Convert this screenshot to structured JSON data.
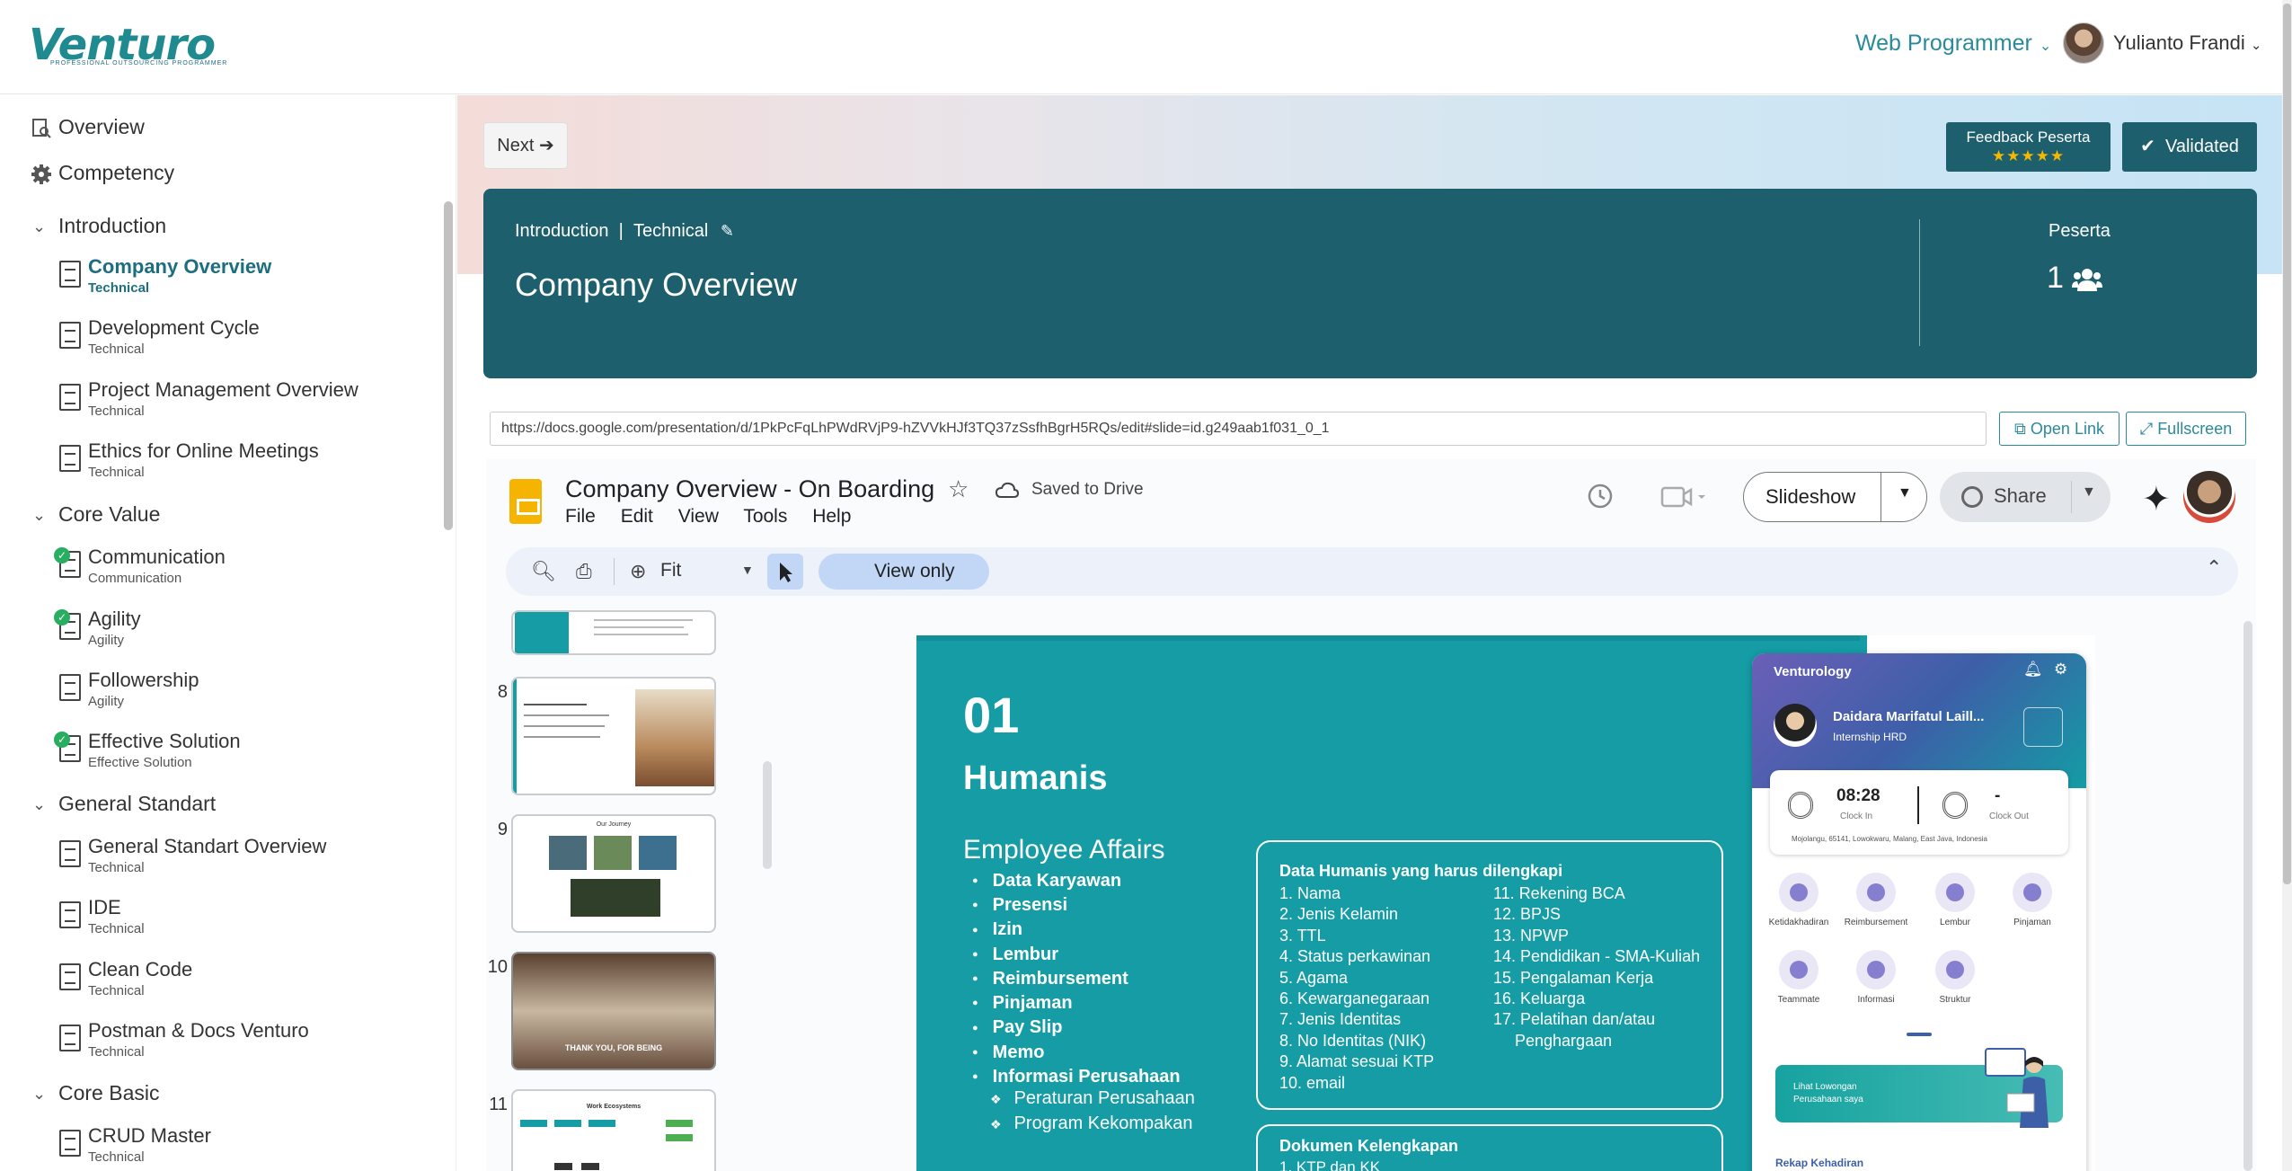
{
  "header": {
    "logo_text": "Venturo",
    "logo_tagline": "PROFESSIONAL OUTSOURCING PROGRAMMER",
    "role_label": "Web Programmer",
    "user_name": "Yulianto Frandi"
  },
  "sidebar": {
    "top_items": [
      {
        "label": "Overview",
        "icon": "overview-icon"
      },
      {
        "label": "Competency",
        "icon": "gear-icon"
      }
    ],
    "sections": [
      {
        "label": "Introduction",
        "items": [
          {
            "title": "Company Overview",
            "subtitle": "Technical",
            "active": true
          },
          {
            "title": "Development Cycle",
            "subtitle": "Technical"
          },
          {
            "title": "Project Management Overview",
            "subtitle": "Technical"
          },
          {
            "title": "Ethics for Online Meetings",
            "subtitle": "Technical"
          }
        ]
      },
      {
        "label": "Core Value",
        "items": [
          {
            "title": "Communication",
            "subtitle": "Communication",
            "done": true
          },
          {
            "title": "Agility",
            "subtitle": "Agility",
            "done": true
          },
          {
            "title": "Followership",
            "subtitle": "Agility"
          },
          {
            "title": "Effective Solution",
            "subtitle": "Effective Solution",
            "done": true
          }
        ]
      },
      {
        "label": "General Standart",
        "items": [
          {
            "title": "General Standart Overview",
            "subtitle": "Technical"
          },
          {
            "title": "IDE",
            "subtitle": "Technical"
          },
          {
            "title": "Clean Code",
            "subtitle": "Technical"
          },
          {
            "title": "Postman & Docs Venturo",
            "subtitle": "Technical"
          }
        ]
      },
      {
        "label": "Core Basic",
        "items": [
          {
            "title": "CRUD Master",
            "subtitle": "Technical"
          }
        ]
      }
    ]
  },
  "actions": {
    "next_label": "Next",
    "feedback_label": "Feedback Peserta",
    "feedback_stars": 5,
    "validated_label": "Validated"
  },
  "banner": {
    "crumb_section": "Introduction",
    "crumb_sep": "|",
    "crumb_category": "Technical",
    "title": "Company Overview",
    "peserta_label": "Peserta",
    "peserta_count": "1"
  },
  "link": {
    "url": "https://docs.google.com/presentation/d/1PkPcFqLhPWdRVjP9-hZVVkHJf3TQ37zSsfhBgrH5RQs/edit#slide=id.g249aab1f031_0_1",
    "open_label": "Open Link",
    "fullscreen_label": "Fullscreen"
  },
  "gslides": {
    "doc_title": "Company Overview - On Boarding",
    "saved_status": "Saved to Drive",
    "menu": [
      "File",
      "Edit",
      "View",
      "Tools",
      "Help"
    ],
    "slideshow_label": "Slideshow",
    "share_label": "Share",
    "zoom_value": "Fit",
    "view_mode": "View only",
    "thumbnails": [
      "8",
      "9",
      "10",
      "11"
    ],
    "thumb10_caption": "THANK YOU, FOR BEING",
    "thumb9_caption": "Our Journey",
    "thumb11_caption": "Work Ecosystems"
  },
  "slide": {
    "number": "01",
    "title": "Humanis",
    "subtitle": "Employee Affairs",
    "bullets": [
      "Data Karyawan",
      "Presensi",
      "Izin",
      "Lembur",
      "Reimbursement",
      "Pinjaman",
      "Pay Slip",
      "Memo",
      "Informasi Perusahaan"
    ],
    "sub_bullets": [
      "Peraturan Perusahaan",
      "Program Kekompakan"
    ],
    "box1_title": "Data Humanis yang harus dilengkapi",
    "box1_col1": [
      "1. Nama",
      "2. Jenis Kelamin",
      "3. TTL",
      "4. Status perkawinan",
      "5. Agama",
      "6. Kewarganegaraan",
      "7. Jenis Identitas",
      "8. No Identitas (NIK)",
      "9. Alamat sesuai KTP",
      "10. email"
    ],
    "box1_col2": [
      "11. Rekening BCA",
      "12. BPJS",
      "13. NPWP",
      "14. Pendidikan - SMA-Kuliah",
      "15. Pengalaman Kerja",
      "16. Keluarga",
      "17. Pelatihan dan/atau",
      "Penghargaan"
    ],
    "box2_title": "Dokumen Kelengkapan",
    "box2_first": "1. KTP dan KK"
  },
  "phone": {
    "app_name": "Venturology",
    "person_name": "Daidara Marifatul Laill...",
    "person_role": "Internship HRD",
    "clock_in_time": "08:28",
    "clock_in_label": "Clock In",
    "clock_out_time": "-",
    "clock_out_label": "Clock Out",
    "address": "Mojolangu, 65141, Lowokwaru, Malang, East Java, Indonesia",
    "menu": [
      "Ketidakhadiran",
      "Reimbursement",
      "Lembur",
      "Pinjaman",
      "Teammate",
      "Informasi",
      "Struktur"
    ],
    "banner_text_1": "Lihat Lowongan",
    "banner_text_2": "Perusahaan saya",
    "rekap": "Rekap Kehadiran"
  },
  "colors": {
    "primary": "#1e5f6e",
    "accent": "#2a8a9c",
    "slide_bg": "#159ca4",
    "star": "#f5b800"
  }
}
